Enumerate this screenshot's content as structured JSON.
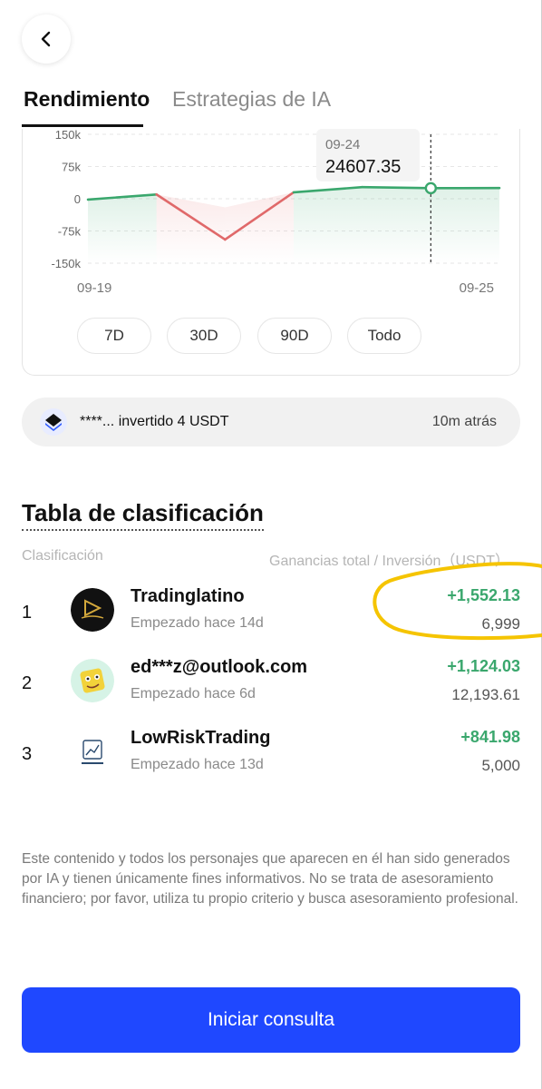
{
  "header": {
    "back_icon": "chevron-left-icon"
  },
  "tabs": [
    {
      "label": "Rendimiento",
      "active": true
    },
    {
      "label": "Estrategias de IA",
      "active": false
    }
  ],
  "chart_data": {
    "type": "line",
    "y_ticks": [
      "150k",
      "75k",
      "0",
      "-75k",
      "-150k"
    ],
    "ylim": [
      -150000,
      150000
    ],
    "x_start_label": "09-19",
    "x_end_label": "09-25",
    "tooltip": {
      "date": "09-24",
      "value": "24607.35"
    },
    "series": [
      {
        "points": [
          {
            "x": 0,
            "y": -2000
          },
          {
            "x": 1,
            "y": 10000
          },
          {
            "x": 2,
            "y": -95000
          },
          {
            "x": 3,
            "y": 15000
          },
          {
            "x": 4,
            "y": 27000
          },
          {
            "x": 5,
            "y": 24607.35
          },
          {
            "x": 6,
            "y": 25000
          }
        ],
        "positive_color": "#3aa76d",
        "negative_color": "#e0696a"
      }
    ],
    "highlight_index": 5
  },
  "ranges": [
    {
      "label": "7D",
      "active": true
    },
    {
      "label": "30D",
      "active": false
    },
    {
      "label": "90D",
      "active": false
    },
    {
      "label": "Todo",
      "active": false
    }
  ],
  "activity": {
    "text": "****... invertido 4 USDT",
    "time": "10m atrás"
  },
  "leaderboard": {
    "title": "Tabla de clasificación",
    "col_rank": "Clasificación",
    "col_gain": "Ganancias total / Inversión（USDT）",
    "rows": [
      {
        "rank": "1",
        "name": "Tradinglatino",
        "started": "Empezado hace 14d",
        "gain": "+1,552.13",
        "invest": "6,999"
      },
      {
        "rank": "2",
        "name": "ed***z@outlook.com",
        "started": "Empezado hace 6d",
        "gain": "+1,124.03",
        "invest": "12,193.61"
      },
      {
        "rank": "3",
        "name": "LowRiskTrading",
        "started": "Empezado hace 13d",
        "gain": "+841.98",
        "invest": "5,000"
      }
    ]
  },
  "disclaimer": "Este contenido y todos los personajes que aparecen en él han sido generados por IA y tienen únicamente fines informativos. No se trata de asesoramiento financiero; por favor, utiliza tu propio criterio y busca asesoramiento profesional.",
  "cta": {
    "label": "Iniciar consulta"
  },
  "colors": {
    "accent": "#1f48ff",
    "gain": "#3aa76d",
    "loss": "#e0696a",
    "highlight_marker": "#f5c400"
  }
}
